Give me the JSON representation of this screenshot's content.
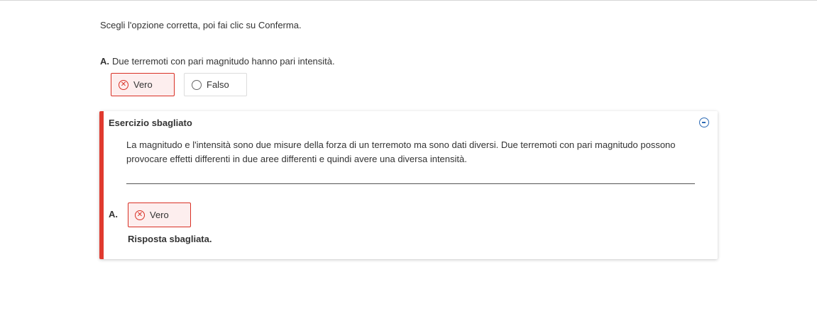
{
  "instruction": "Scegli l'opzione corretta, poi fai clic su Conferma.",
  "question": {
    "letter": "A.",
    "text": "Due terremoti con pari magnitudo hanno pari intensità."
  },
  "options": [
    {
      "label": "Vero",
      "state": "selected-wrong",
      "icon": "x-circle-icon"
    },
    {
      "label": "Falso",
      "state": "unselected",
      "icon": "radio-icon"
    }
  ],
  "feedback": {
    "title": "Esercizio sbagliato",
    "collapse_icon": "minus-circle-icon",
    "explanation": "La magnitudo e l'intensità sono due misure della forza di un terremoto ma sono dati diversi. Due terremoti con pari magnitudo possono provocare effetti differenti in due aree differenti e quindi avere una diversa intensità.",
    "answer_letter": "A.",
    "answer_label": "Vero",
    "result": "Risposta sbagliata."
  },
  "colors": {
    "error": "#d93025",
    "error_bar": "#e03a2f",
    "error_bg": "#fdeeee",
    "accent": "#2c6ab5"
  }
}
